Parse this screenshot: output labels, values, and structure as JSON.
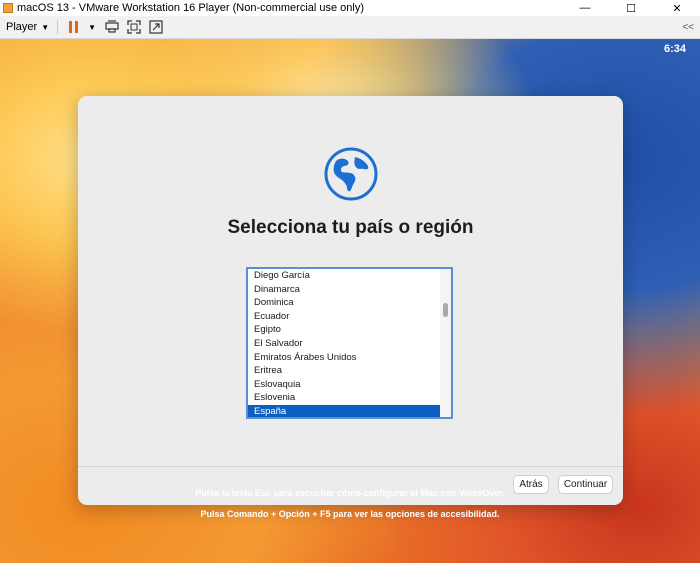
{
  "window": {
    "title": "macOS 13 - VMware Workstation 16 Player (Non-commercial use only)",
    "minimize": "—",
    "maximize": "☐",
    "close": "✕"
  },
  "toolbar": {
    "player_label": "Player",
    "collapse_label": "<<"
  },
  "desktop": {
    "clock": "6:34"
  },
  "dialog": {
    "title": "Selecciona tu país o región",
    "countries": [
      "Diego García",
      "Dinamarca",
      "Dominica",
      "Ecuador",
      "Egipto",
      "El Salvador",
      "Emiratos Árabes Unidos",
      "Eritrea",
      "Eslovaquia",
      "Eslovenia",
      "España"
    ],
    "selected": "España",
    "back_label": "Atrás",
    "continue_label": "Continuar"
  },
  "hints": {
    "line1": "Pulsa la tecla Esc para escuchar cómo configurar el Mac con VoiceOver.",
    "line2": "Pulsa Comando + Opción + F5 para ver las opciones de accesibilidad."
  },
  "colors": {
    "accent": "#0a5fc0",
    "globe": "#1d6fd1",
    "pause": "#e0641a"
  }
}
